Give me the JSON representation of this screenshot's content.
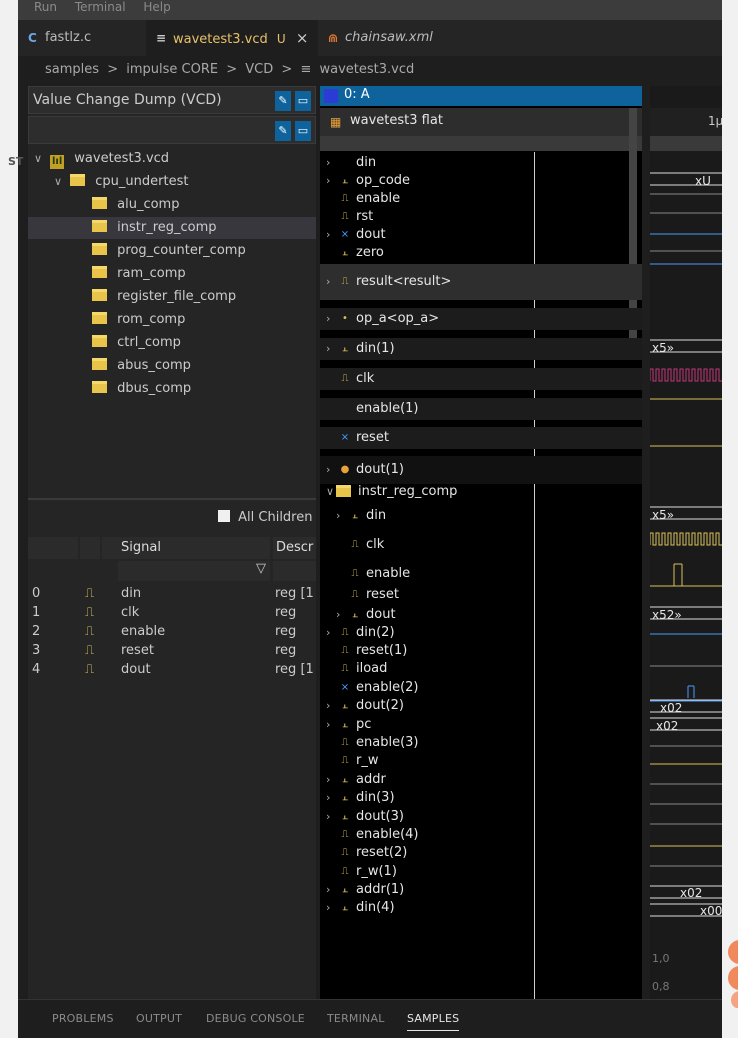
{
  "menubar": {
    "items": [
      "Run",
      "Terminal",
      "Help"
    ]
  },
  "tabs": [
    {
      "icon": "C",
      "label": "fastlz.c",
      "active": false,
      "italic": false,
      "modified": ""
    },
    {
      "icon": "≡",
      "label": "wavetest3.vcd",
      "active": true,
      "italic": false,
      "modified": "U"
    },
    {
      "icon": "⋒",
      "label": "chainsaw.xml",
      "active": false,
      "italic": true,
      "modified": ""
    }
  ],
  "tab_close": "×",
  "breadcrumb": [
    "samples",
    "impulse CORE",
    "VCD",
    "wavetest3.vcd"
  ],
  "breadcrumb_sep": ">",
  "left_panel": {
    "title": "Value Change Dump (VCD)",
    "tree": [
      {
        "label": "wavetest3.vcd",
        "depth": 0,
        "chevron": "∨",
        "icon": "vcd",
        "selected": false
      },
      {
        "label": "cpu_undertest",
        "depth": 1,
        "chevron": "∨",
        "icon": "folder",
        "selected": false
      },
      {
        "label": "alu_comp",
        "depth": 2,
        "chevron": "",
        "icon": "folder",
        "selected": false
      },
      {
        "label": "instr_reg_comp",
        "depth": 2,
        "chevron": "",
        "icon": "folder",
        "selected": true
      },
      {
        "label": "prog_counter_comp",
        "depth": 2,
        "chevron": "",
        "icon": "folder",
        "selected": false
      },
      {
        "label": "ram_comp",
        "depth": 2,
        "chevron": "",
        "icon": "folder",
        "selected": false
      },
      {
        "label": "register_file_comp",
        "depth": 2,
        "chevron": "",
        "icon": "folder",
        "selected": false
      },
      {
        "label": "rom_comp",
        "depth": 2,
        "chevron": "",
        "icon": "folder",
        "selected": false
      },
      {
        "label": "ctrl_comp",
        "depth": 2,
        "chevron": "",
        "icon": "folder",
        "selected": false
      },
      {
        "label": "abus_comp",
        "depth": 2,
        "chevron": "",
        "icon": "folder",
        "selected": false
      },
      {
        "label": "dbus_comp",
        "depth": 2,
        "chevron": "",
        "icon": "folder",
        "selected": false
      }
    ],
    "all_children_label": "All Children",
    "columns": {
      "signal": "Signal",
      "description": "Descr"
    },
    "rows": [
      {
        "index": "0",
        "icon": "⎍",
        "name": "din",
        "desc": "reg [1"
      },
      {
        "index": "1",
        "icon": "⎍",
        "name": "clk",
        "desc": "reg"
      },
      {
        "index": "2",
        "icon": "⎍",
        "name": "enable",
        "desc": "reg"
      },
      {
        "index": "3",
        "icon": "⎍",
        "name": "reset",
        "desc": "reg"
      },
      {
        "index": "4",
        "icon": "⎍",
        "name": "dout",
        "desc": "reg [1"
      }
    ]
  },
  "viewer": {
    "selection_label": "0: A",
    "flat_title": "wavetest3 flat",
    "signals": [
      {
        "name": "din",
        "top": 0,
        "chevron": true,
        "icon": ""
      },
      {
        "name": "op_code",
        "chevron": true,
        "icon": "bus"
      },
      {
        "name": "enable",
        "chevron": false,
        "icon": "clk"
      },
      {
        "name": "rst",
        "chevron": false,
        "icon": "clk"
      },
      {
        "name": "dout",
        "chevron": true,
        "icon": "rst"
      },
      {
        "name": "zero",
        "chevron": false,
        "icon": "bus"
      },
      {
        "name": "result<result>",
        "chevron": true,
        "icon": "clk",
        "highlight": true
      },
      {
        "name": "op_a<op_a>",
        "chevron": true,
        "icon": "dot"
      },
      {
        "name": "din(1)",
        "chevron": true,
        "icon": "bus"
      },
      {
        "name": "clk",
        "chevron": false,
        "icon": "clk"
      },
      {
        "name": "enable(1)",
        "chevron": false,
        "icon": ""
      },
      {
        "name": "reset",
        "chevron": false,
        "icon": "rst"
      },
      {
        "name": "dout(1)",
        "chevron": true,
        "icon": "int",
        "dark": true
      },
      {
        "name": "instr_reg_comp",
        "chevron": true,
        "icon": "folder"
      },
      {
        "name": "din",
        "chevron": true,
        "icon": "bus",
        "indent": true
      },
      {
        "name": "clk",
        "chevron": false,
        "icon": "clk",
        "indent": true
      },
      {
        "name": "enable",
        "chevron": false,
        "icon": "clk",
        "indent": true
      },
      {
        "name": "reset",
        "chevron": false,
        "icon": "clk",
        "indent": true
      },
      {
        "name": "dout",
        "chevron": true,
        "icon": "bus",
        "indent": true
      },
      {
        "name": "din(2)",
        "chevron": true,
        "icon": "clk"
      },
      {
        "name": "reset(1)",
        "chevron": false,
        "icon": "clk"
      },
      {
        "name": "iload",
        "chevron": false,
        "icon": "clk"
      },
      {
        "name": "enable(2)",
        "chevron": false,
        "icon": "rst"
      },
      {
        "name": "dout(2)",
        "chevron": true,
        "icon": "bus"
      },
      {
        "name": "pc",
        "chevron": true,
        "icon": "bus"
      },
      {
        "name": "enable(3)",
        "chevron": false,
        "icon": "clk"
      },
      {
        "name": "r_w",
        "chevron": false,
        "icon": "clk"
      },
      {
        "name": "addr",
        "chevron": true,
        "icon": "bus"
      },
      {
        "name": "din(3)",
        "chevron": true,
        "icon": "bus"
      },
      {
        "name": "dout(3)",
        "chevron": true,
        "icon": "bus"
      },
      {
        "name": "enable(4)",
        "chevron": false,
        "icon": "clk"
      },
      {
        "name": "reset(2)",
        "chevron": false,
        "icon": "clk"
      },
      {
        "name": "r_w(1)",
        "chevron": false,
        "icon": "clk"
      },
      {
        "name": "addr(1)",
        "chevron": true,
        "icon": "bus"
      },
      {
        "name": "din(4)",
        "chevron": true,
        "icon": "bus"
      }
    ]
  },
  "waveform": {
    "ruler_label": "1µ",
    "labels": [
      "xU",
      "x5»",
      "x5»",
      "x52»",
      "x02",
      "x02",
      "x02",
      "x00"
    ],
    "scale_labels": [
      "1,0",
      "0,8"
    ]
  },
  "bottom_panel": {
    "tabs": [
      "PROBLEMS",
      "OUTPUT",
      "DEBUG CONSOLE",
      "TERMINAL",
      "SAMPLES"
    ],
    "active": "SAMPLES"
  },
  "colors": {
    "accent": "#0e639c",
    "selection": "#37373d",
    "signal_yellow": "#d8c35a",
    "signal_blue": "#4a9aff",
    "signal_pink": "#c2357a"
  }
}
